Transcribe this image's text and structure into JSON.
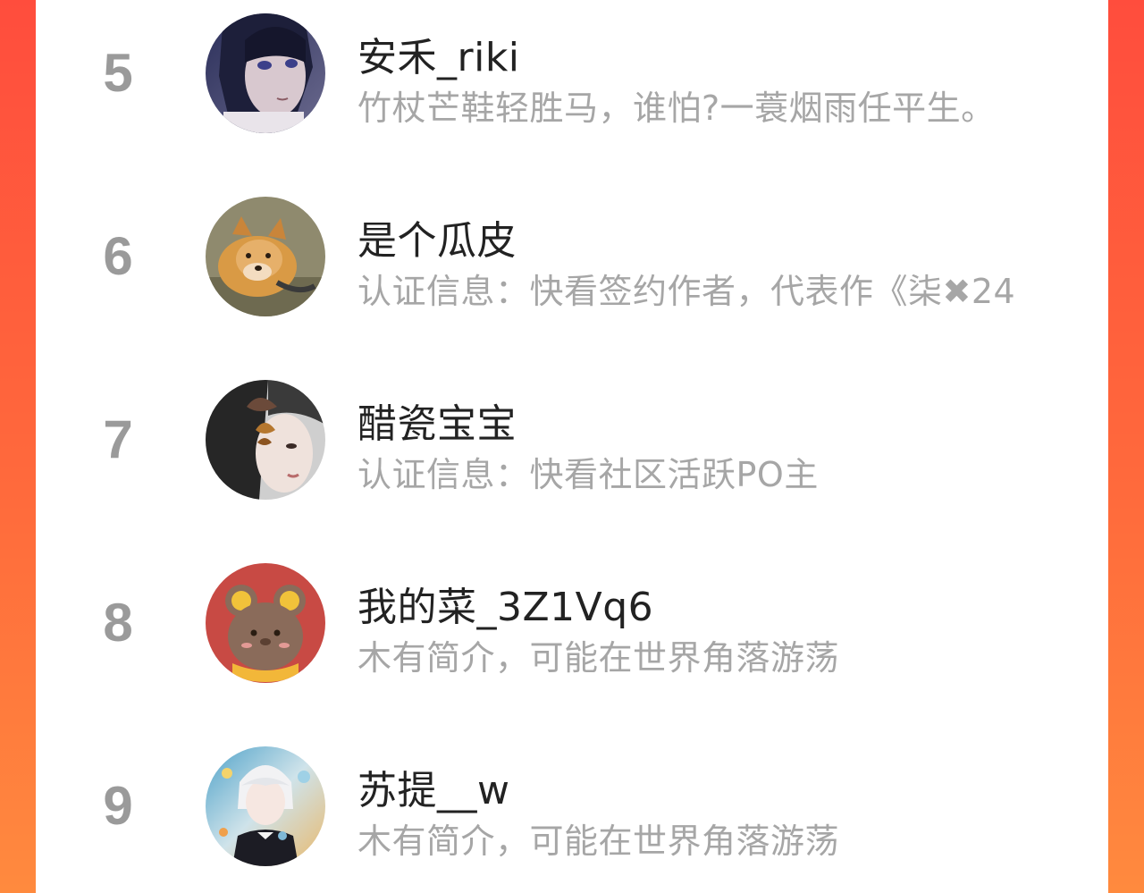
{
  "rankings": [
    {
      "rank": "5",
      "name": "安禾_riki",
      "bio": "竹杖芒鞋轻胜马，谁怕?一蓑烟雨任平生。",
      "avatar": "anime-girl-avatar-icon"
    },
    {
      "rank": "6",
      "name": "是个瓜皮",
      "bio": "认证信息：快看签约作者，代表作《柒✖24",
      "avatar": "shiba-dog-avatar-icon"
    },
    {
      "rank": "7",
      "name": "醋瓷宝宝",
      "bio": "认证信息：快看社区活跃PO主",
      "avatar": "butterfly-girl-avatar-icon"
    },
    {
      "rank": "8",
      "name": "我的菜_3Z1Vq6",
      "bio": "木有简介，可能在世界角落游荡",
      "avatar": "bear-avatar-icon"
    },
    {
      "rank": "9",
      "name": "苏提__w",
      "bio": "木有简介，可能在世界角落游荡",
      "avatar": "anime-boy-avatar-icon"
    }
  ],
  "colors": {
    "background_gradient_top": "#ff4d3d",
    "background_gradient_bottom": "#ff8a3e",
    "rank_color": "#9a9a9a",
    "name_color": "#222222",
    "bio_color": "#a6a6a6"
  }
}
